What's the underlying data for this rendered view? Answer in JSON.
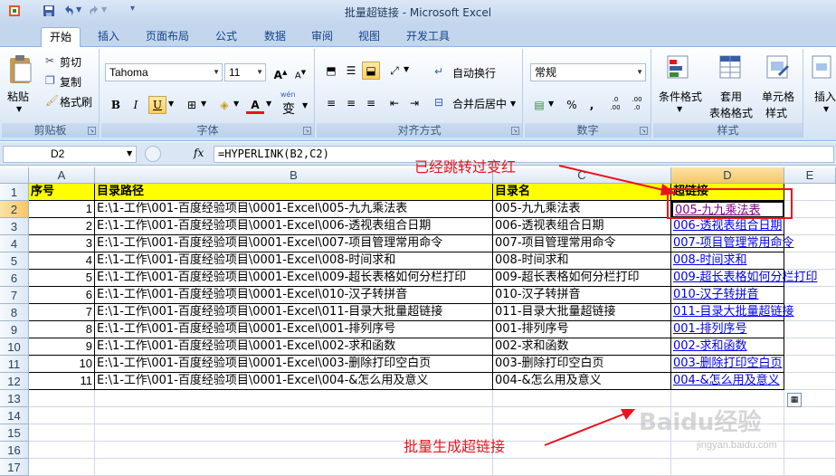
{
  "window": {
    "title": "批量超链接 - Microsoft Excel"
  },
  "qat": [
    "save-icon",
    "undo-icon",
    "redo-icon",
    "customize-icon"
  ],
  "tabs": [
    "开始",
    "插入",
    "页面布局",
    "公式",
    "数据",
    "审阅",
    "视图",
    "开发工具"
  ],
  "ribbon": {
    "clipboard": {
      "label": "剪贴板",
      "paste": "粘贴",
      "cut": "剪切",
      "copy": "复制",
      "format_painter": "格式刷"
    },
    "font": {
      "label": "字体",
      "name": "Tahoma",
      "size": "11",
      "bold": "B",
      "italic": "I",
      "underline": "U",
      "increase": "A",
      "decrease": "A",
      "color_letter": "A",
      "wen": "wén",
      "wen_char": "变"
    },
    "alignment": {
      "label": "对齐方式",
      "wrap": "自动换行",
      "merge": "合并后居中"
    },
    "number": {
      "label": "数字",
      "format": "常规",
      "percent": "%",
      "comma": ",",
      "dec_inc": ".0 .00",
      "dec_dec": ".00 .0"
    },
    "styles": {
      "label": "样式",
      "conditional": "条件格式",
      "table_line1": "套用",
      "table_line2": "表格格式",
      "cell_line1": "单元格",
      "cell_line2": "样式"
    },
    "cells": {
      "insert": "插入"
    }
  },
  "formula_bar": {
    "name_box": "D2",
    "fx": "fx",
    "formula": "=HYPERLINK(B2,C2)"
  },
  "grid": {
    "columns": [
      "A",
      "B",
      "C",
      "D",
      "E"
    ],
    "rows": [
      "1",
      "2",
      "3",
      "4",
      "5",
      "6",
      "7",
      "8",
      "9",
      "10",
      "11",
      "12",
      "13",
      "14",
      "15",
      "16",
      "17"
    ],
    "header": [
      "序号",
      "目录路径",
      "目录名",
      "超链接"
    ],
    "data": [
      [
        "1",
        "E:\\1-工作\\001-百度经验项目\\0001-Excel\\005-九九乘法表",
        "005-九九乘法表",
        "005-九九乘法表"
      ],
      [
        "2",
        "E:\\1-工作\\001-百度经验项目\\0001-Excel\\006-透视表组合日期",
        "006-透视表组合日期",
        "006-透视表组合日期"
      ],
      [
        "3",
        "E:\\1-工作\\001-百度经验项目\\0001-Excel\\007-项目管理常用命令",
        "007-项目管理常用命令",
        "007-项目管理常用命令"
      ],
      [
        "4",
        "E:\\1-工作\\001-百度经验项目\\0001-Excel\\008-时间求和",
        "008-时间求和",
        "008-时间求和"
      ],
      [
        "5",
        "E:\\1-工作\\001-百度经验项目\\0001-Excel\\009-超长表格如何分栏打印",
        "009-超长表格如何分栏打印",
        "009-超长表格如何分栏打印"
      ],
      [
        "6",
        "E:\\1-工作\\001-百度经验项目\\0001-Excel\\010-汉子转拼音",
        "010-汉子转拼音",
        "010-汉子转拼音"
      ],
      [
        "7",
        "E:\\1-工作\\001-百度经验项目\\0001-Excel\\011-目录大批量超链接",
        "011-目录大批量超链接",
        "011-目录大批量超链接"
      ],
      [
        "8",
        "E:\\1-工作\\001-百度经验项目\\0001-Excel\\001-排列序号",
        "001-排列序号",
        "001-排列序号"
      ],
      [
        "9",
        "E:\\1-工作\\001-百度经验项目\\0001-Excel\\002-求和函数",
        "002-求和函数",
        "002-求和函数"
      ],
      [
        "10",
        "E:\\1-工作\\001-百度经验项目\\0001-Excel\\003-删除打印空白页",
        "003-删除打印空白页",
        "003-删除打印空白页"
      ],
      [
        "11",
        "E:\\1-工作\\001-百度经验项目\\0001-Excel\\004-&怎么用及意义",
        "004-&怎么用及意义",
        "004-&怎么用及意义"
      ]
    ]
  },
  "annotations": {
    "visited_note": "已经跳转过变红",
    "batch_note": "批量生成超链接"
  },
  "watermark": {
    "main": "Baidu经验",
    "sub": "jingyan.baidu.com"
  },
  "colors": {
    "link": "#0000ee",
    "visited": "#800080",
    "header_fill": "#ffff00",
    "annotation": "#e8141d"
  }
}
